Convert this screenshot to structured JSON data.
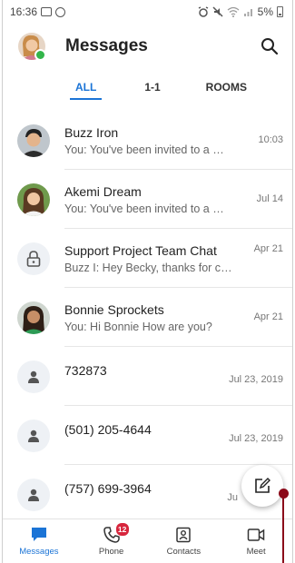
{
  "status_bar": {
    "time": "16:36",
    "battery": "5%"
  },
  "header": {
    "title": "Messages"
  },
  "tabs": [
    {
      "label": "ALL",
      "active": true
    },
    {
      "label": "1-1",
      "active": false
    },
    {
      "label": "ROOMS",
      "active": false
    }
  ],
  "conversations": [
    {
      "name": "Buzz Iron",
      "preview": "You: You've been invited to a me...",
      "time": "10:03",
      "avatar": "photo"
    },
    {
      "name": "Akemi Dream",
      "preview": "You: You've been invited to a me...",
      "time": "Jul 14",
      "avatar": "photo"
    },
    {
      "name": "Support Project Team Chat",
      "preview": "Buzz I: Hey Becky, thanks for creati...",
      "time": "Apr 21",
      "avatar": "lock-icon"
    },
    {
      "name": "Bonnie Sprockets",
      "preview": "You: Hi Bonnie How are you?",
      "time": "Apr 21",
      "avatar": "photo"
    },
    {
      "name": "732873",
      "preview": "",
      "time": "Jul 23, 2019",
      "avatar": "person-icon"
    },
    {
      "name": "(501) 205-4644",
      "preview": "",
      "time": "Jul 23, 2019",
      "avatar": "person-icon"
    },
    {
      "name": "(757) 699-3964",
      "preview": "",
      "time": "Ju",
      "avatar": "person-icon"
    }
  ],
  "bottom_nav": {
    "messages": "Messages",
    "phone": "Phone",
    "phone_badge": "12",
    "contacts": "Contacts",
    "meet": "Meet"
  },
  "colors": {
    "accent": "#1b74d6",
    "presence": "#33b54a",
    "badge": "#d7263d",
    "annotation": "#8b0a1a"
  }
}
